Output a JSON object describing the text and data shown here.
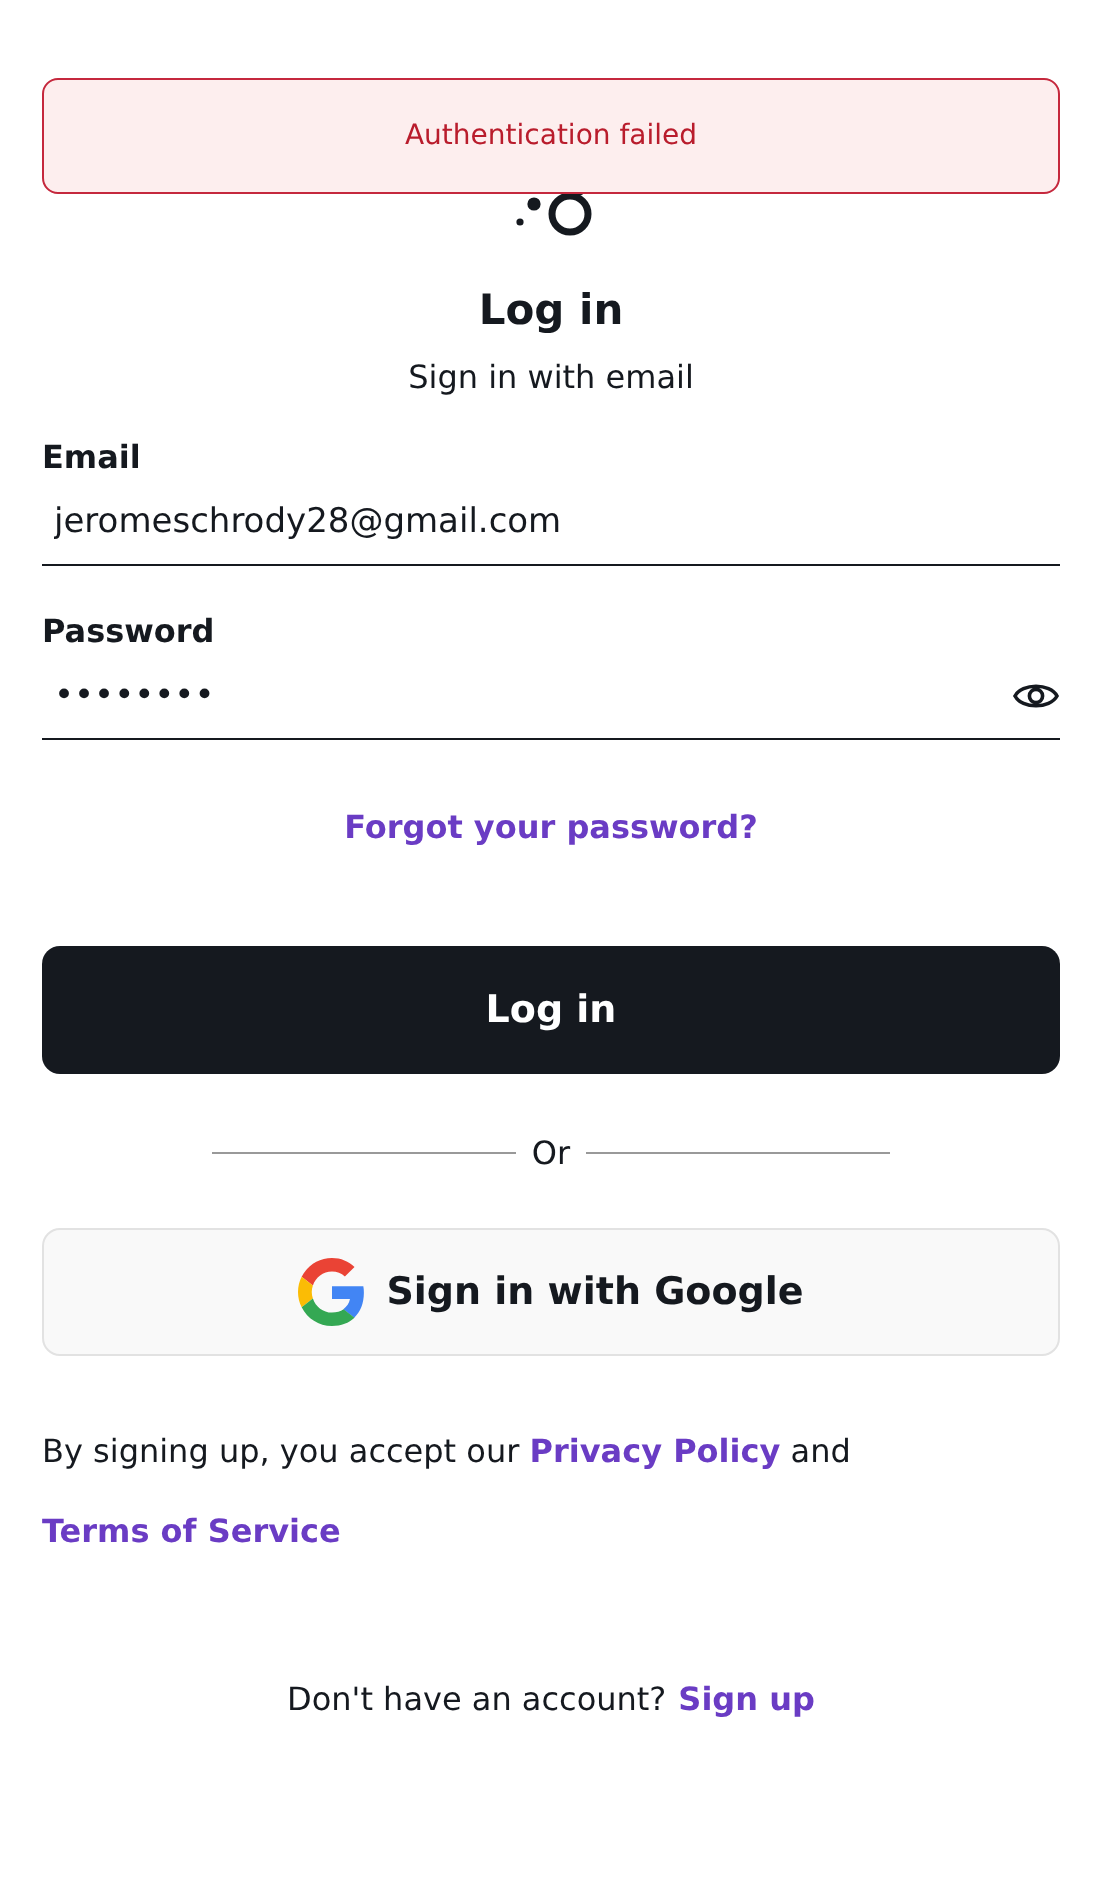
{
  "toast": {
    "message": "Authentication failed",
    "kind": "error"
  },
  "title": "Log in",
  "subtitle": "Sign in with email",
  "fields": [
    {
      "label": "Email",
      "value": "jeromeschrody28@gmail.com",
      "kind": "text"
    },
    {
      "label": "Password",
      "value": "••••••••",
      "kind": "password"
    }
  ],
  "forgot_link": "Forgot your password?",
  "login_button": "Log in",
  "divider": "Or",
  "google_button": "Sign in with Google",
  "legal": {
    "before": "By signing up, you accept our",
    "privacy_link": "Privacy Policy",
    "middle": "and",
    "terms_link": "Terms of Service"
  },
  "signup": {
    "prompt": "Don't have an account?",
    "link": "Sign up"
  }
}
